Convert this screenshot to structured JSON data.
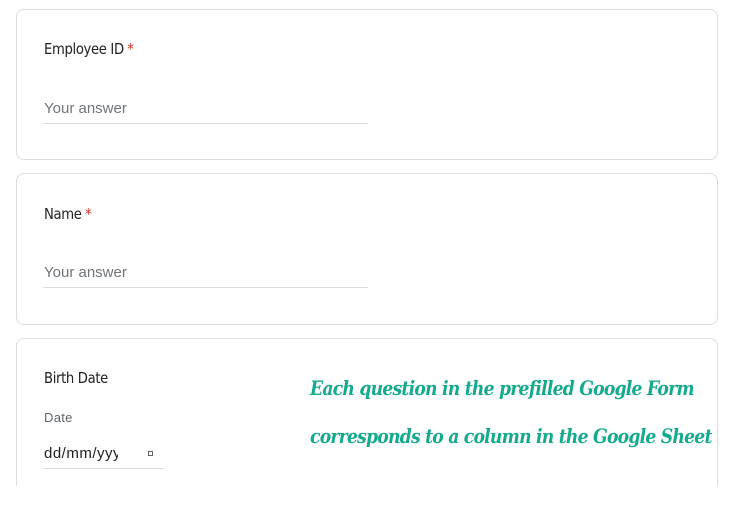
{
  "form": {
    "questions": [
      {
        "title": "Employee ID",
        "required_mark": "*",
        "placeholder": "Your answer"
      },
      {
        "title": "Name",
        "required_mark": "*",
        "placeholder": "Your answer"
      },
      {
        "title": "Birth Date",
        "sub_label": "Date",
        "date_value": "dd/mm/yyyy"
      }
    ]
  },
  "annotation": {
    "line1": "Each question in the prefilled Google Form",
    "line2": "corresponds to a column in the Google Sheet"
  },
  "colors": {
    "required": "#d93025",
    "annotation": "#15a98e",
    "card_border": "#dadce0"
  },
  "icons": {
    "date_picker": "calendar-icon"
  }
}
